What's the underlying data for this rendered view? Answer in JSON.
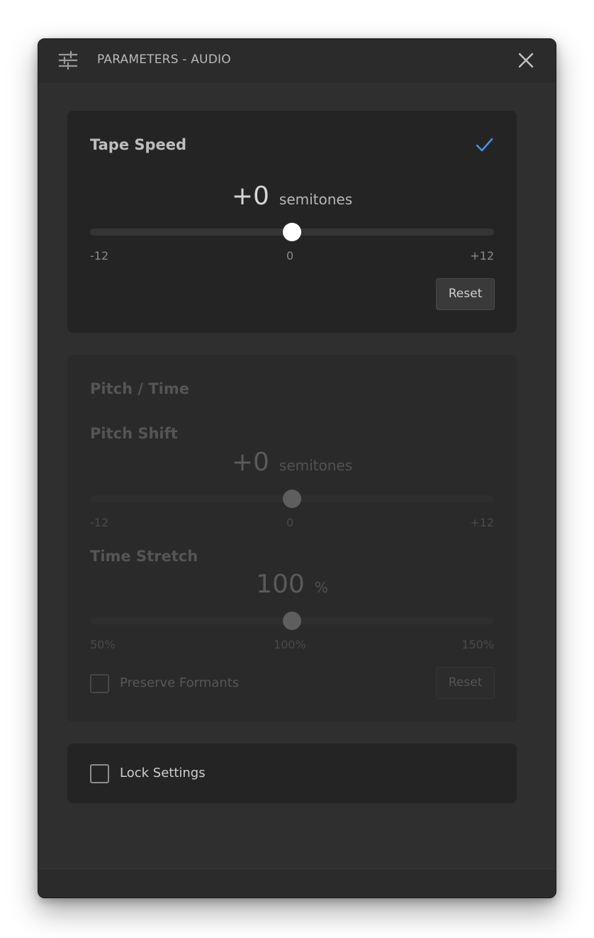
{
  "window": {
    "title": "PARAMETERS - AUDIO"
  },
  "icons": {
    "settings": "sliders-icon",
    "close": "close-icon",
    "check": "checkmark-icon"
  },
  "colors": {
    "accent": "#4a90e2",
    "card_bg": "#242424",
    "window_bg": "#2f2f2f"
  },
  "tape_speed": {
    "title": "Tape Speed",
    "enabled": true,
    "value": "+0",
    "unit": "semitones",
    "slider_value": 0,
    "min": -12,
    "max": 12,
    "ticks": [
      "-12",
      "0",
      "+12"
    ],
    "reset_label": "Reset"
  },
  "pitch_time": {
    "title": "Pitch / Time",
    "enabled": false,
    "pitch_shift": {
      "label": "Pitch Shift",
      "value": "+0",
      "unit": "semitones",
      "slider_value": 0,
      "min": -12,
      "max": 12,
      "ticks": [
        "-12",
        "0",
        "+12"
      ]
    },
    "time_stretch": {
      "label": "Time Stretch",
      "value": "100",
      "unit": "%",
      "slider_value": 100,
      "min": 50,
      "max": 150,
      "ticks": [
        "50%",
        "100%",
        "150%"
      ]
    },
    "preserve_formants": {
      "label": "Preserve Formants",
      "checked": false
    },
    "reset_label": "Reset"
  },
  "lock": {
    "label": "Lock Settings",
    "checked": false
  }
}
